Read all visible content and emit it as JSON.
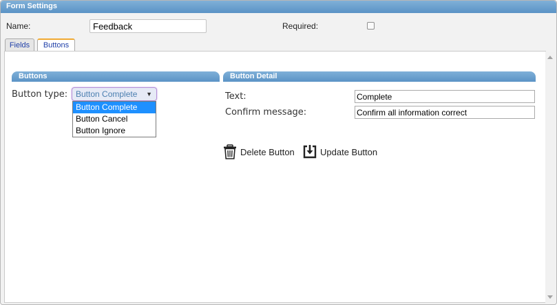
{
  "window": {
    "title": "Form Settings"
  },
  "form": {
    "name_label": "Name:",
    "name_value": "Feedback",
    "required_label": "Required:",
    "required_checked": false
  },
  "tabs": [
    {
      "label": "Fields",
      "active": false
    },
    {
      "label": "Buttons",
      "active": true
    }
  ],
  "buttons_section": {
    "header": "Buttons",
    "type_label": "Button type:",
    "selected": "Button Complete",
    "options": [
      "Button Complete",
      "Button Cancel",
      "Button Ignore"
    ],
    "highlighted_option": "Button Complete"
  },
  "detail_section": {
    "header": "Button Detail",
    "text_label": "Text:",
    "text_value": "Complete",
    "confirm_label": "Confirm message:",
    "confirm_value": "Confirm all information correct"
  },
  "actions": {
    "delete_label": "Delete Button",
    "delete_icon": "trash-icon",
    "update_label": "Update Button",
    "update_icon": "save-icon"
  },
  "colors": {
    "header_blue": "#6ea3d2",
    "active_tab_accent": "#f0a830",
    "option_highlight": "#1e90ff",
    "tab_text": "#1f3fa8"
  }
}
